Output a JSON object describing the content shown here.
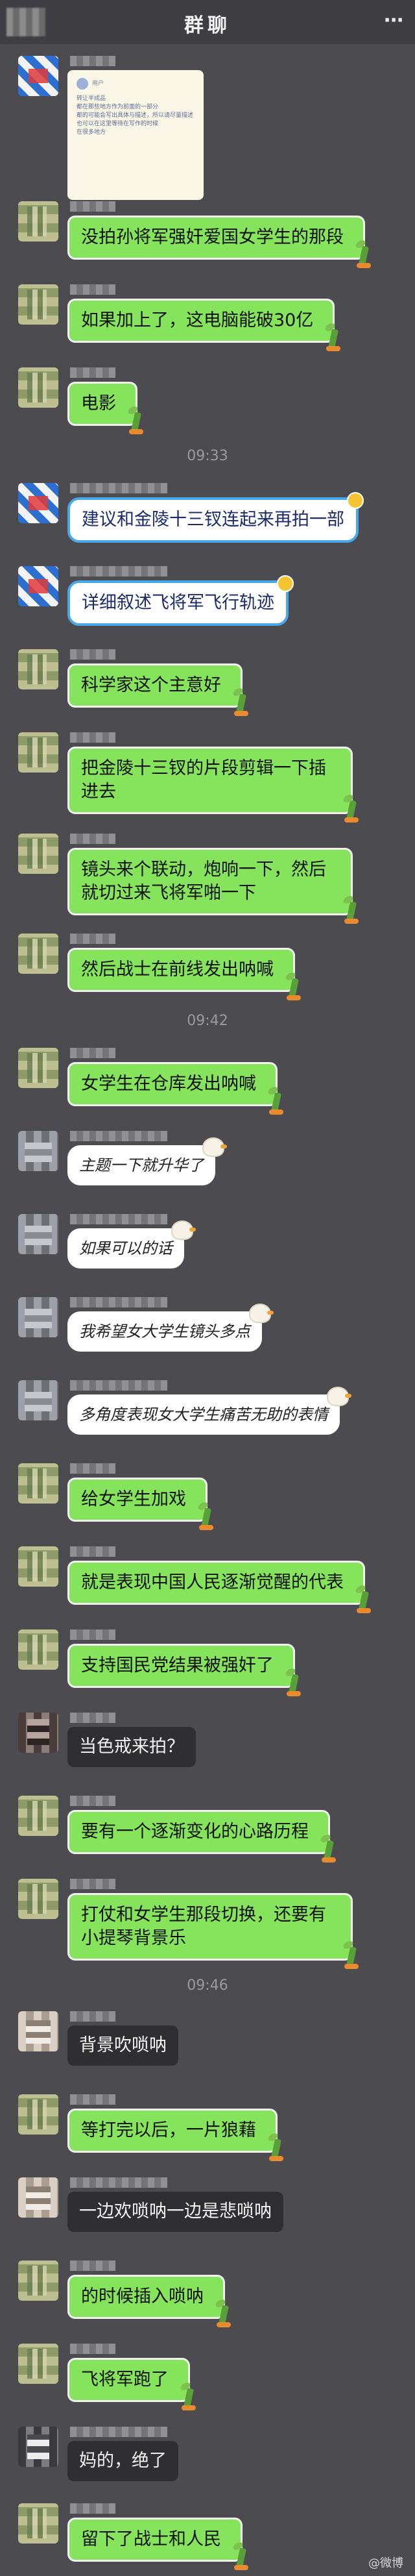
{
  "header": {
    "title": "群聊"
  },
  "note_card": {
    "name": "用户",
    "lines": [
      "转让半成品",
      "都在那些地方作为前面的一部分",
      "都的可能会写出具体与描述，所以请尽量描述",
      "也可以在这里等待在写作的时候",
      "在很多地方"
    ]
  },
  "timestamps": [
    "09:33",
    "09:42",
    "09:46"
  ],
  "messages": [
    {
      "text": "没拍孙将军强奸爱国女学生的那段"
    },
    {
      "text": "如果加上了，这电脑能破30亿"
    },
    {
      "text": "电影"
    },
    {
      "text": "建议和金陵十三钗连起来再拍一部"
    },
    {
      "text": "详细叙述飞将军飞行轨迹"
    },
    {
      "text": "科学家这个主意好"
    },
    {
      "text": "把金陵十三钗的片段剪辑一下插进去"
    },
    {
      "text": "镜头来个联动，炮响一下，然后就切过来飞将军啪一下"
    },
    {
      "text": "然后战士在前线发出呐喊"
    },
    {
      "text": "女学生在仓库发出呐喊"
    },
    {
      "text": "主题一下就升华了"
    },
    {
      "text": "如果可以的话"
    },
    {
      "text": "我希望女大学生镜头多点"
    },
    {
      "text": "多角度表现女大学生痛苦无助的表情"
    },
    {
      "text": "给女学生加戏"
    },
    {
      "text": "就是表现中国人民逐渐觉醒的代表"
    },
    {
      "text": "支持国民党结果被强奸了"
    },
    {
      "text": "当色戒来拍？"
    },
    {
      "text": "要有一个逐渐变化的心路历程"
    },
    {
      "text": "打仗和女学生那段切换，还要有小提琴背景乐"
    },
    {
      "text": "背景吹唢呐"
    },
    {
      "text": "等打完以后，一片狼藉"
    },
    {
      "text": "一边欢唢呐一边是悲唢呐"
    },
    {
      "text": "的时候插入唢呐"
    },
    {
      "text": "飞将军跑了"
    },
    {
      "text": "妈的，绝了"
    },
    {
      "text": "留下了战士和人民"
    }
  ],
  "footer": {
    "watermark": "@微博"
  },
  "colors": {
    "background": "#4c4c50",
    "green_bubble": "#86e35c",
    "blue_border": "#4aa7e8",
    "dark_bubble": "#2f2f33"
  }
}
